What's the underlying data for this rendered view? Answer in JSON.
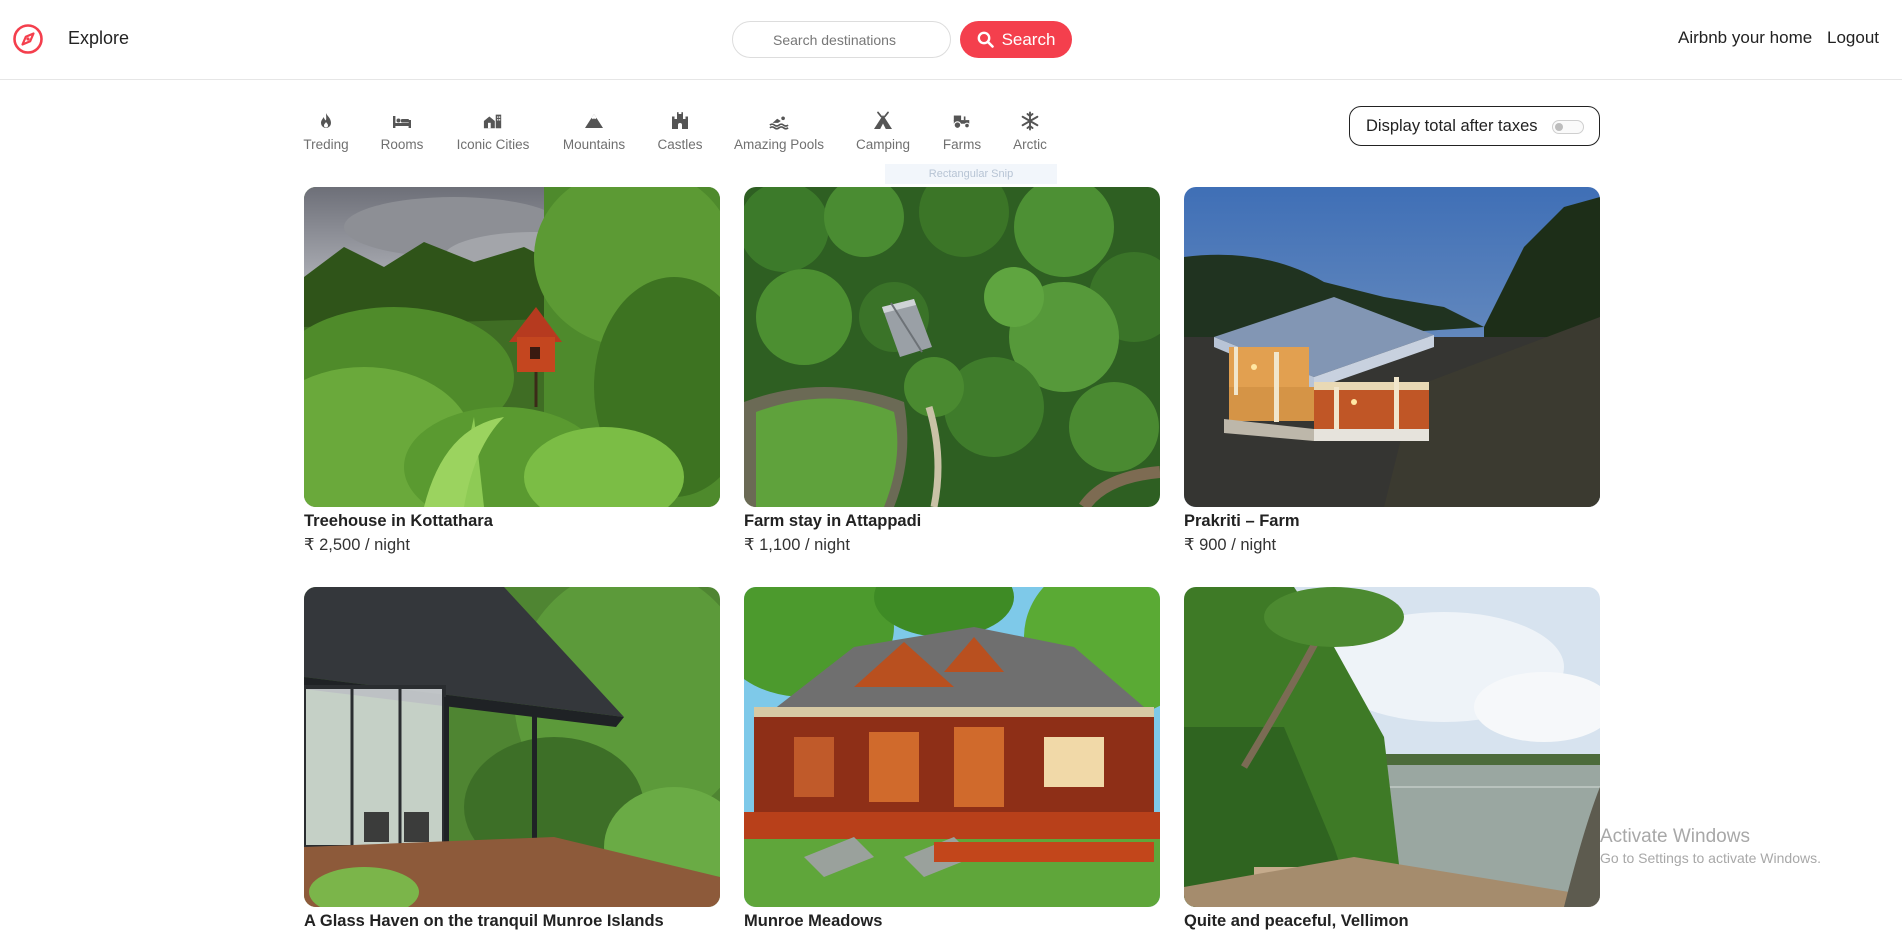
{
  "navbar": {
    "explore_label": "Explore",
    "search_placeholder": "Search destinations",
    "search_button_label": "Search",
    "host_link_label": "Airbnb your home",
    "logout_label": "Logout",
    "brand_color": "#f43f4d"
  },
  "filters": [
    {
      "label": "Treding",
      "icon": "fire-icon"
    },
    {
      "label": "Rooms",
      "icon": "bed-icon"
    },
    {
      "label": "Iconic Cities",
      "icon": "city-icon"
    },
    {
      "label": "Mountains",
      "icon": "mountain-icon"
    },
    {
      "label": "Castles",
      "icon": "castle-icon"
    },
    {
      "label": "Amazing Pools",
      "icon": "swimmer-icon"
    },
    {
      "label": "Camping",
      "icon": "tent-icon"
    },
    {
      "label": "Farms",
      "icon": "tractor-icon"
    },
    {
      "label": "Arctic",
      "icon": "snowflake-icon"
    }
  ],
  "tooltip_ghost_text": "Rectangular Snip",
  "tax_toggle": {
    "label": "Display total after taxes",
    "enabled": false
  },
  "listings": [
    {
      "title": "Treehouse in Kottathara",
      "price": "₹ 2,500 / night"
    },
    {
      "title": "Farm stay in Attappadi",
      "price": "₹ 1,100 / night"
    },
    {
      "title": "Prakriti – Farm",
      "price": "₹ 900 / night"
    },
    {
      "title": "A Glass Haven on the tranquil Munroe Islands",
      "price": ""
    },
    {
      "title": "Munroe Meadows",
      "price": ""
    },
    {
      "title": "Quite and peaceful, Vellimon",
      "price": ""
    }
  ],
  "watermark": {
    "line1": "Activate Windows",
    "line2": "Go to Settings to activate Windows."
  }
}
